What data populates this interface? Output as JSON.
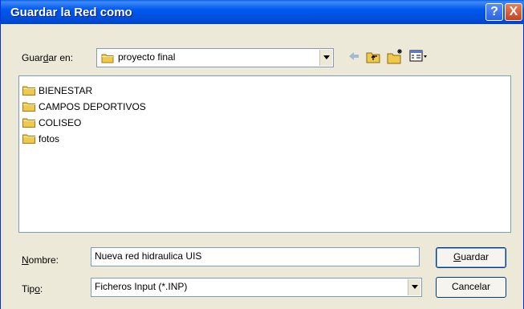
{
  "window": {
    "title": "Guardar la Red como"
  },
  "titlebar_buttons": {
    "help": "?",
    "close": "X"
  },
  "save_in": {
    "label_pre": "Guar",
    "label_accel": "d",
    "label_post": "ar en:",
    "value": "proyecto final"
  },
  "toolbar": {
    "icons": [
      "back-arrow-icon",
      "up-folder-icon",
      "new-folder-icon",
      "view-menu-icon"
    ]
  },
  "files": [
    {
      "name": "BIENESTAR",
      "icon": "folder-icon"
    },
    {
      "name": "CAMPOS DEPORTIVOS",
      "icon": "folder-icon"
    },
    {
      "name": "COLISEO",
      "icon": "folder-icon"
    },
    {
      "name": "fotos",
      "icon": "folder-icon"
    }
  ],
  "filename": {
    "label_accel": "N",
    "label_post": "ombre:",
    "value": "Nueva red hidraulica UIS"
  },
  "filetype": {
    "label_pre": "Tip",
    "label_accel": "o",
    "label_post": ":",
    "value": "Ficheros Input (*.INP)"
  },
  "buttons": {
    "save_accel": "G",
    "save_post": "uardar",
    "cancel": "Cancelar"
  },
  "colors": {
    "titlebar": "#0058ee",
    "folder": "#f2c84b",
    "face": "#ece9d8"
  }
}
